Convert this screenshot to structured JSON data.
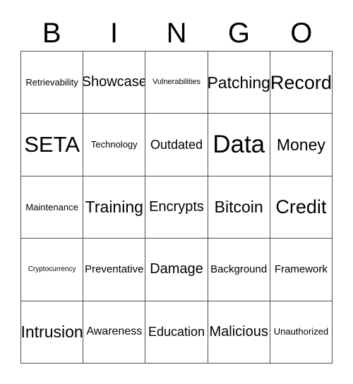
{
  "card": {
    "header_letters": [
      "B",
      "I",
      "N",
      "G",
      "O"
    ],
    "rows": [
      [
        {
          "label": "Retrievability",
          "size": "fs-s"
        },
        {
          "label": "Showcase",
          "size": "fs-l"
        },
        {
          "label": "Vulnerabilities",
          "size": "fs-xs"
        },
        {
          "label": "Patching",
          "size": "fs-xl"
        },
        {
          "label": "Record",
          "size": "fs-xxl"
        }
      ],
      [
        {
          "label": "SETA",
          "size": "fs-3xl"
        },
        {
          "label": "Technology",
          "size": "fs-s"
        },
        {
          "label": "Outdated",
          "size": "fs-ml"
        },
        {
          "label": "Data",
          "size": "fs-4xl"
        },
        {
          "label": "Money",
          "size": "fs-xl"
        }
      ],
      [
        {
          "label": "Maintenance",
          "size": "fs-s"
        },
        {
          "label": "Training",
          "size": "fs-xl"
        },
        {
          "label": "Encrypts",
          "size": "fs-l"
        },
        {
          "label": "Bitcoin",
          "size": "fs-xl"
        },
        {
          "label": "Credit",
          "size": "fs-xxl"
        }
      ],
      [
        {
          "label": "Cryptocurrency",
          "size": "fs-xxs"
        },
        {
          "label": "Preventative",
          "size": "fs-ms"
        },
        {
          "label": "Damage",
          "size": "fs-l"
        },
        {
          "label": "Background",
          "size": "fs-ms"
        },
        {
          "label": "Framework",
          "size": "fs-ms"
        }
      ],
      [
        {
          "label": "Intrusion",
          "size": "fs-xl"
        },
        {
          "label": "Awareness",
          "size": "fs-m"
        },
        {
          "label": "Education",
          "size": "fs-ml"
        },
        {
          "label": "Malicious",
          "size": "fs-l"
        },
        {
          "label": "Unauthorized",
          "size": "fs-s"
        }
      ]
    ]
  },
  "colors": {
    "background": "#ffffff",
    "text": "#000000",
    "grid_line": "#4d4d4d"
  }
}
